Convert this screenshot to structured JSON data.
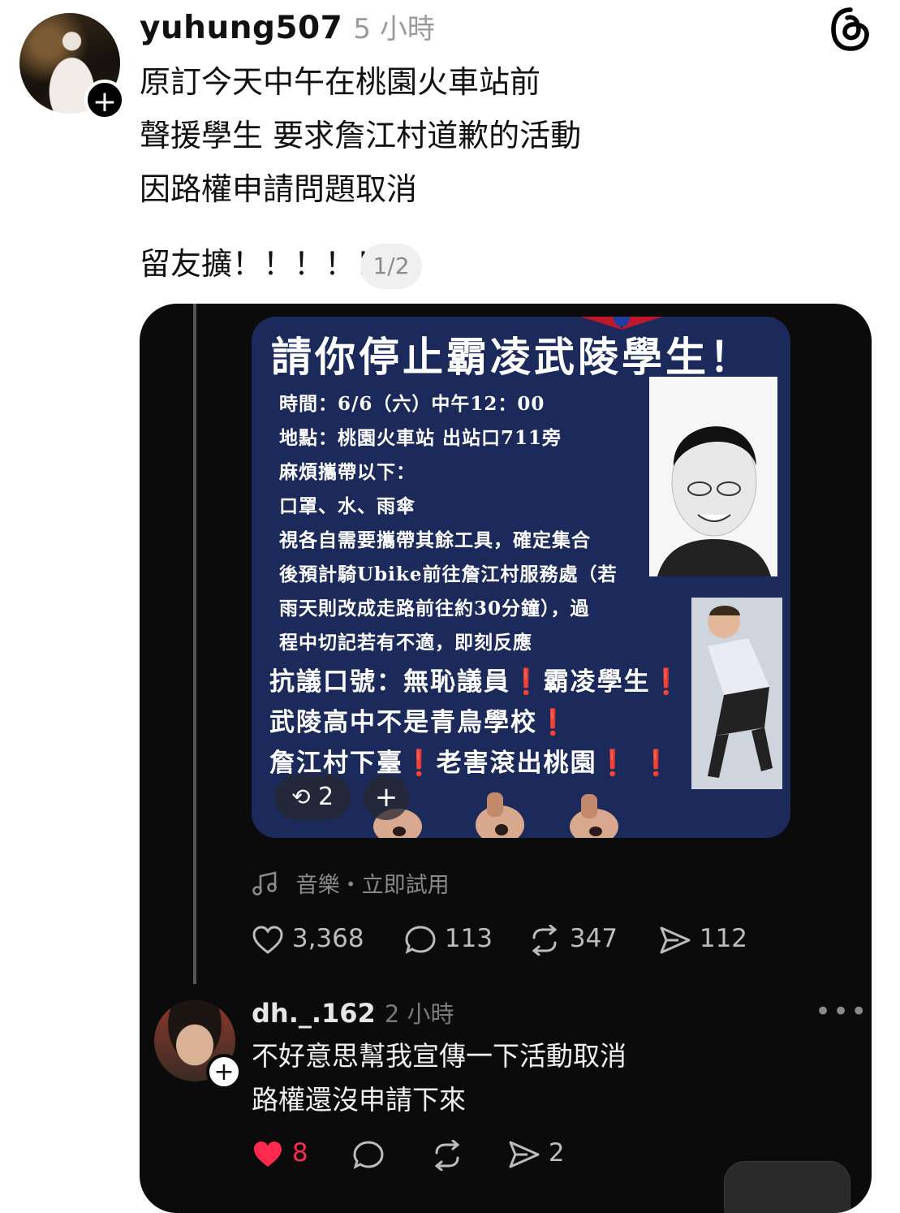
{
  "post": {
    "username": "yuhung507",
    "time": "5 小時",
    "lines": [
      "原訂今天中午在桃園火車站前",
      "聲援學生 要求詹江村道歉的活動",
      "因路權申請問題取消"
    ],
    "closing": "留友擴！！！！！",
    "counter": "1/2"
  },
  "icons": {
    "app_logo": "threads-logo-icon",
    "follow": "plus-icon"
  },
  "embedded": {
    "poster": {
      "title": "請你停止霸凌武陵學生！",
      "lines": [
        "時間：6/6（六）中午12：00",
        "地點：桃園火車站 出站口711旁",
        "麻煩攜帶以下：",
        "口罩、水、雨傘",
        "視各自需要攜帶其餘工具，確定集合",
        "後預計騎Ubike前往詹江村服務處（若",
        "雨天則改成走路前往約30分鐘），過",
        "程中切記若有不適，即刻反應"
      ],
      "slogans": [
        {
          "a": "抗議口號：無恥議員",
          "b": "霸凌學生"
        },
        {
          "a": "武陵高中不是青鳥學校"
        },
        {
          "a": "詹江村下臺",
          "b": "老害滾出桃園"
        }
      ],
      "repost_count": "2"
    },
    "music": "音樂・立即試用",
    "stats": {
      "likes": "3,368",
      "comments": "113",
      "reposts": "347",
      "shares": "112"
    },
    "reply": {
      "username": "dh._.162",
      "time": "2 小時",
      "lines": [
        "不好意思幫我宣傳一下活動取消",
        "路權還沒申請下來"
      ],
      "likes": "8",
      "shares": "2"
    },
    "colors": {
      "heart": "#ff2a4d",
      "bang": "#e01b1b",
      "poster_bg": "#1b2a5a"
    }
  }
}
